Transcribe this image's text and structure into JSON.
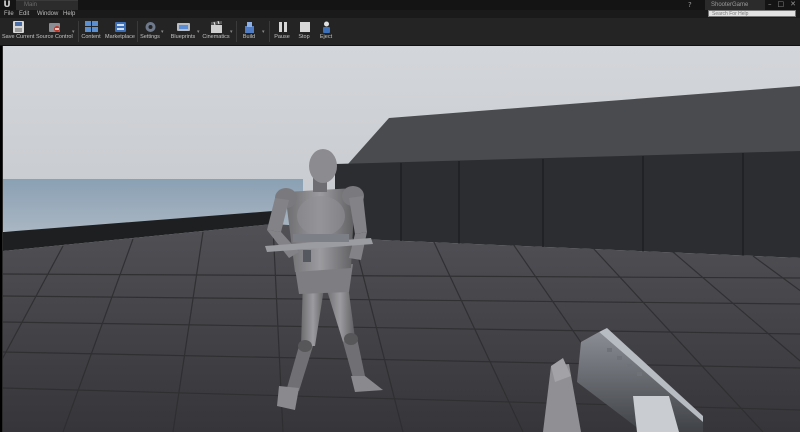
{
  "window": {
    "tab_title": "Main",
    "project_name": "ShooterGame",
    "help_symbol": "?"
  },
  "menu": {
    "items": [
      "File",
      "Edit",
      "Window",
      "Help"
    ],
    "search_placeholder": "Search For Help"
  },
  "toolbar": {
    "save_current": "Save Current",
    "source_control": "Source Control",
    "content": "Content",
    "marketplace": "Marketplace",
    "settings": "Settings",
    "blueprints": "Blueprints",
    "cinematics": "Cinematics",
    "build": "Build",
    "pause": "Pause",
    "stop": "Stop",
    "eject": "Eject"
  },
  "viewport": {
    "scene": "level-viewport"
  },
  "colors": {
    "toolbar_bg": "#242424",
    "sky_top": "#c9ccd0",
    "floor": "#3c3c3f"
  }
}
